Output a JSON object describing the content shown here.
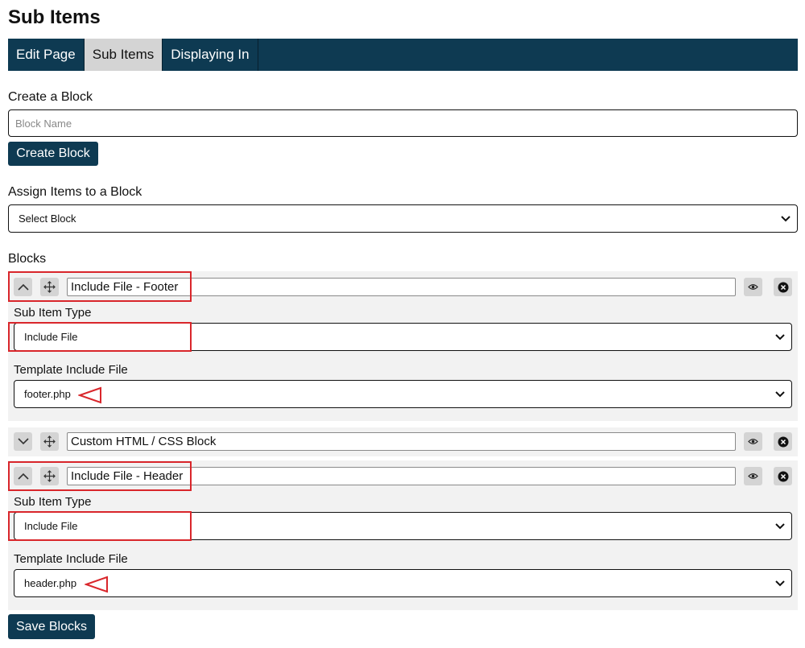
{
  "page": {
    "title": "Sub Items"
  },
  "tabs": [
    {
      "label": "Edit Page",
      "active": false
    },
    {
      "label": "Sub Items",
      "active": true
    },
    {
      "label": "Displaying In",
      "active": false
    }
  ],
  "create_block": {
    "heading": "Create a Block",
    "placeholder": "Block Name",
    "button": "Create Block"
  },
  "assign": {
    "heading": "Assign Items to a Block",
    "select_value": "Select Block"
  },
  "blocks": {
    "heading": "Blocks",
    "items": [
      {
        "name": "Include File - Footer",
        "expanded": true,
        "sub_item_type_label": "Sub Item Type",
        "sub_item_type": "Include File",
        "template_label": "Template Include File",
        "template_file": "footer.php"
      },
      {
        "name": "Custom HTML / CSS Block",
        "expanded": false
      },
      {
        "name": "Include File - Header",
        "expanded": true,
        "sub_item_type_label": "Sub Item Type",
        "sub_item_type": "Include File",
        "template_label": "Template Include File",
        "template_file": "header.php"
      }
    ]
  },
  "save_button": "Save Blocks",
  "icons": {
    "collapse": "chevron-up-icon",
    "expand": "chevron-down-icon",
    "move": "move-arrows-icon",
    "visibility": "eye-icon",
    "delete": "close-circle-icon",
    "dropdown": "chevron-down-icon"
  },
  "colors": {
    "navbar": "#0e3a52",
    "active_tab": "#d4d4d4",
    "panel": "#f2f2f2",
    "annotation": "#d9262b"
  }
}
